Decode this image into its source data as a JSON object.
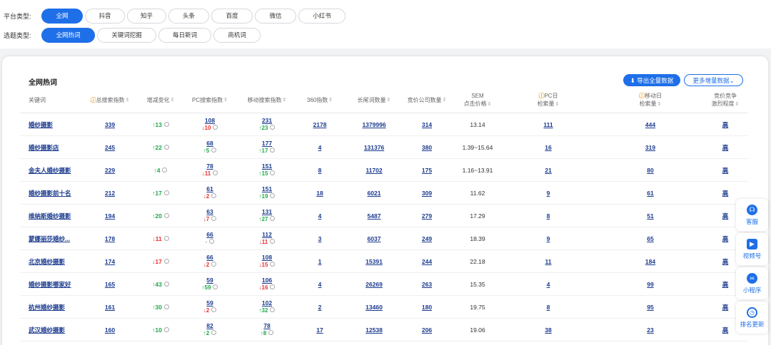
{
  "filters": {
    "platform_label": "平台类型:",
    "platforms": [
      "全网",
      "抖音",
      "知乎",
      "头条",
      "百度",
      "微信",
      "小红书"
    ],
    "topic_label": "选题类型:",
    "topics": [
      "全网热词",
      "关键词挖掘",
      "每日新词",
      "商机词"
    ]
  },
  "panel": {
    "title": "全网热词",
    "export_label": "⬇ 导出全量数据",
    "more_label": "更多增量数据⌄"
  },
  "columns": {
    "keyword": "关键词",
    "total": "总搜索指数",
    "change": "增减变化",
    "pc": "PC搜索指数",
    "mobile": "移动搜索指数",
    "i360": "360指数",
    "longtail": "长尾词数量",
    "bidders": "竞价公司数量",
    "sem_line1": "SEM",
    "sem_line2": "点击价格",
    "pcday_line1": "PC日",
    "pcday_line2": "检索量",
    "mday_line1": "移动日",
    "mday_line2": "检索量",
    "comp_line1": "竞价竞争",
    "comp_line2": "激烈程度"
  },
  "rows": [
    {
      "kw": "婚纱摄影",
      "total": "339",
      "chg": "↑13",
      "pc": "108",
      "pcchg": "↓10",
      "mob": "231",
      "mobchg": "↑23",
      "i360": "2178",
      "lt": "1379996",
      "bid": "314",
      "sem": "13.14",
      "pcday": "111",
      "mday": "444",
      "comp": "高"
    },
    {
      "kw": "婚纱摄影店",
      "total": "245",
      "chg": "↑22",
      "pc": "68",
      "pcchg": "↑5",
      "mob": "177",
      "mobchg": "↑17",
      "i360": "4",
      "lt": "131376",
      "bid": "380",
      "sem": "1.39~15.64",
      "pcday": "16",
      "mday": "319",
      "comp": "高"
    },
    {
      "kw": "金夫人婚纱摄影",
      "total": "229",
      "chg": "↑4",
      "pc": "78",
      "pcchg": "↓11",
      "mob": "151",
      "mobchg": "↑15",
      "i360": "8",
      "lt": "11702",
      "bid": "175",
      "sem": "1.16~13.91",
      "pcday": "21",
      "mday": "80",
      "comp": "高"
    },
    {
      "kw": "婚纱摄影前十名",
      "total": "212",
      "chg": "↑17",
      "pc": "61",
      "pcchg": "↓2",
      "mob": "151",
      "mobchg": "↑19",
      "i360": "18",
      "lt": "6021",
      "bid": "309",
      "sem": "11.62",
      "pcday": "9",
      "mday": "61",
      "comp": "高"
    },
    {
      "kw": "维纳斯婚纱摄影",
      "total": "194",
      "chg": "↑20",
      "pc": "63",
      "pcchg": "↓7",
      "mob": "131",
      "mobchg": "↑27",
      "i360": "4",
      "lt": "5487",
      "bid": "279",
      "sem": "17.29",
      "pcday": "8",
      "mday": "51",
      "comp": "高"
    },
    {
      "kw": "蒙娜丽莎婚纱...",
      "total": "178",
      "chg": "↓11",
      "pc": "66",
      "pcchg": "-",
      "mob": "112",
      "mobchg": "↓11",
      "i360": "3",
      "lt": "6037",
      "bid": "249",
      "sem": "18.39",
      "pcday": "9",
      "mday": "65",
      "comp": "高"
    },
    {
      "kw": "北京婚纱摄影",
      "total": "174",
      "chg": "↓17",
      "pc": "66",
      "pcchg": "↓2",
      "mob": "108",
      "mobchg": "↓15",
      "i360": "1",
      "lt": "15391",
      "bid": "244",
      "sem": "22.18",
      "pcday": "11",
      "mday": "184",
      "comp": "高"
    },
    {
      "kw": "婚纱摄影哪家好",
      "total": "165",
      "chg": "↑43",
      "pc": "59",
      "pcchg": "↑59",
      "mob": "106",
      "mobchg": "↓16",
      "i360": "4",
      "lt": "26269",
      "bid": "263",
      "sem": "15.35",
      "pcday": "4",
      "mday": "99",
      "comp": "高"
    },
    {
      "kw": "杭州婚纱摄影",
      "total": "161",
      "chg": "↑30",
      "pc": "59",
      "pcchg": "↓2",
      "mob": "102",
      "mobchg": "↑32",
      "i360": "2",
      "lt": "13460",
      "bid": "180",
      "sem": "19.75",
      "pcday": "8",
      "mday": "95",
      "comp": "高"
    },
    {
      "kw": "武汉婚纱摄影",
      "total": "160",
      "chg": "↑10",
      "pc": "82",
      "pcchg": "↑2",
      "mob": "78",
      "mobchg": "↑8",
      "i360": "17",
      "lt": "12538",
      "bid": "206",
      "sem": "19.06",
      "pcday": "38",
      "mday": "23",
      "comp": "高"
    }
  ],
  "sidebar": [
    {
      "label": "客服",
      "icon": "headset-icon"
    },
    {
      "label": "视频号",
      "icon": "video-icon"
    },
    {
      "label": "小程序",
      "icon": "miniprogram-icon"
    },
    {
      "label": "排名更新",
      "icon": "history-icon"
    }
  ]
}
